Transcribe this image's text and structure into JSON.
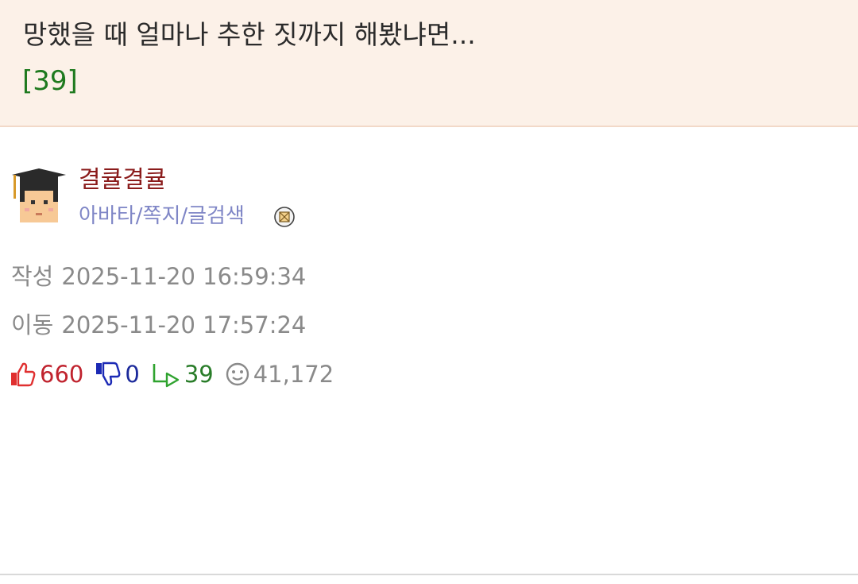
{
  "post": {
    "title": "망했을 때 얼마나 추한 짓까지 해봤냐면...",
    "comment_count": "[39]"
  },
  "author": {
    "nickname": "결큘결큘",
    "links": [
      "아바타",
      "쪽지",
      "글검색"
    ],
    "link_separator": "/"
  },
  "meta": {
    "created_label": "작성",
    "created_value": "2025-11-20 16:59:34",
    "moved_label": "이동",
    "moved_value": "2025-11-20 17:57:24"
  },
  "stats": {
    "upvotes": "660",
    "downvotes": "0",
    "replies": "39",
    "views": "41,172"
  },
  "colors": {
    "title_bg": "#fcf1e8",
    "comment_count": "#1f7a1f",
    "nickname": "#8b1c1c",
    "links": "#7f86c6",
    "upvote": "#c0232e",
    "downvote": "#1c2a9b",
    "reply": "#2a7d2a",
    "meta": "#8a8a8a"
  },
  "icons": {
    "avatar": "graduate-avatar-icon",
    "memo": "memo-icon",
    "upvote": "thumbs-up-icon",
    "downvote": "thumbs-down-icon",
    "reply": "reply-arrow-icon",
    "views": "smiley-views-icon"
  }
}
